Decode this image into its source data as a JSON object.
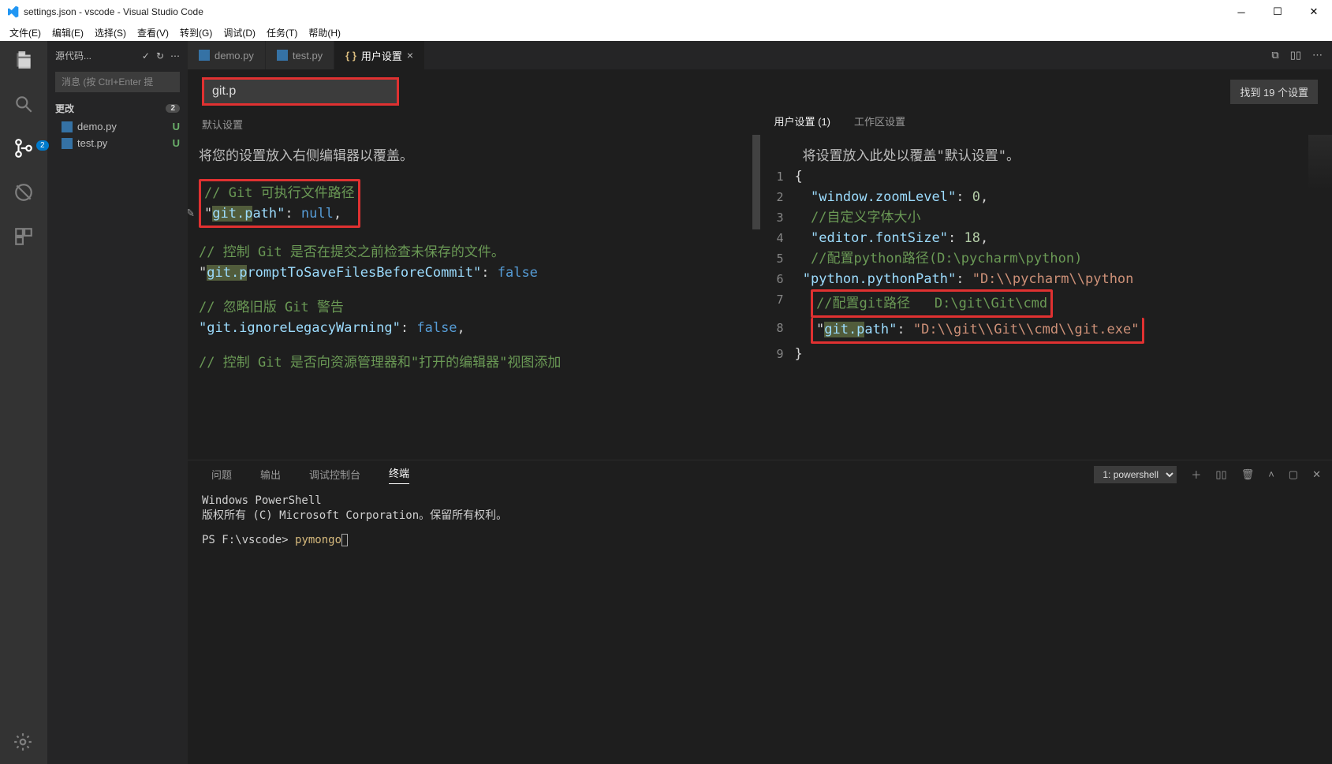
{
  "window_title": "settings.json - vscode - Visual Studio Code",
  "menubar": [
    "文件(E)",
    "编辑(E)",
    "选择(S)",
    "查看(V)",
    "转到(G)",
    "调试(D)",
    "任务(T)",
    "帮助(H)"
  ],
  "sidebar": {
    "header": "源代码...",
    "search_placeholder": "消息 (按 Ctrl+Enter 提",
    "changes_label": "更改",
    "changes_count": "2",
    "files": [
      {
        "name": "demo.py",
        "status": "U"
      },
      {
        "name": "test.py",
        "status": "U"
      }
    ]
  },
  "tabs": [
    {
      "label": "demo.py",
      "icon": "python"
    },
    {
      "label": "test.py",
      "icon": "python"
    },
    {
      "label": "用户设置",
      "icon": "braces",
      "active": true,
      "closable": true
    }
  ],
  "settings": {
    "search_value": "git.p",
    "found_label": "找到 19 个设置",
    "left_tab": "默认设置",
    "right_tabs": [
      "用户设置 (1)",
      "工作区设置"
    ],
    "left_hint": "将您的设置放入右侧编辑器以覆盖。",
    "right_hint": "将设置放入此处以覆盖\"默认设置\"。",
    "left_code": {
      "c1": "// Git 可执行文件路径",
      "k1": "\"git.path\"",
      "v1": "null",
      "c2": "// 控制 Git 是否在提交之前检查未保存的文件。",
      "k2": "\"git.promptToSaveFilesBeforeCommit\"",
      "v2": "false",
      "c3": "// 忽略旧版 Git 警告",
      "k3": "\"git.ignoreLegacyWarning\"",
      "v3": "false",
      "c4": "// 控制 Git 是否向资源管理器和\"打开的编辑器\"视图添加"
    },
    "right_code": {
      "l1": "{",
      "l2k": "\"window.zoomLevel\"",
      "l2v": "0",
      "l3": "//自定义字体大小",
      "l4k": "\"editor.fontSize\"",
      "l4v": "18",
      "l5": "//配置python路径(D:\\pycharm\\python)",
      "l6k": "\"python.pythonPath\"",
      "l6v": "\"D:\\\\pycharm\\\\python",
      "l7": "//配置git路径   D:\\git\\Git\\cmd",
      "l8k": "\"git.path\"",
      "l8v": "\"D:\\\\git\\\\Git\\\\cmd\\\\git.exe\"",
      "l9": "}"
    },
    "line_numbers": [
      "1",
      "2",
      "3",
      "4",
      "5",
      "6",
      "7",
      "8",
      "9"
    ]
  },
  "panel": {
    "tabs": [
      "问题",
      "输出",
      "调试控制台",
      "终端"
    ],
    "active": "终端",
    "select": "1: powershell",
    "term_line1": "Windows PowerShell",
    "term_line2": "版权所有 (C) Microsoft Corporation。保留所有权利。",
    "prompt_prefix": "PS F:\\vscode> ",
    "prompt_cmd": "pymongo"
  },
  "scm_badge": "2"
}
